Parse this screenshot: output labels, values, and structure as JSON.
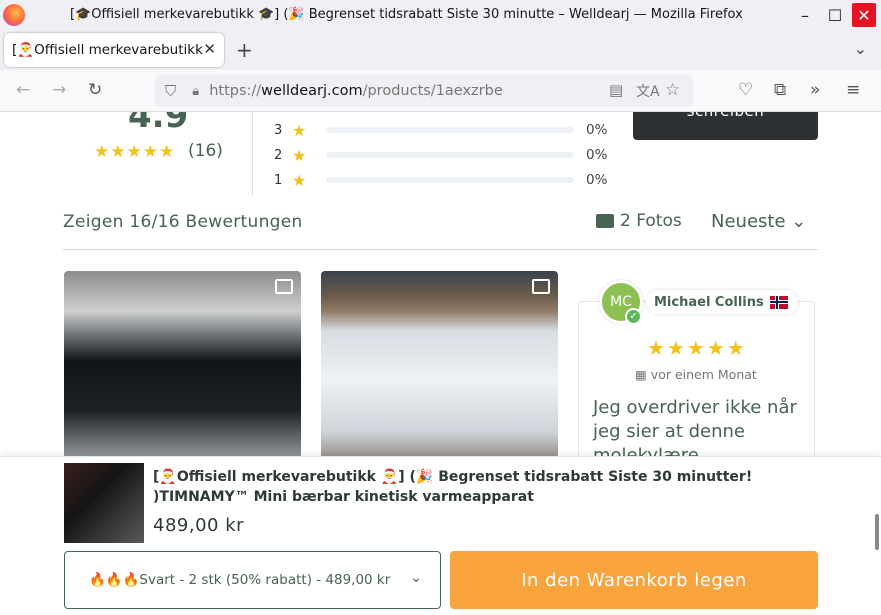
{
  "window": {
    "title": "[🎓Offisiell merkevarebutikk 🎓] (🎉 Begrenset tidsrabatt Siste 30 minutte – Welldearj — Mozilla Firefox"
  },
  "tabs": [
    {
      "label": "[🎅Offisiell merkevarebutikk"
    }
  ],
  "url": {
    "scheme": "https://",
    "host": "welldearj.com",
    "path": "/products/1aexzrbe"
  },
  "rating": {
    "average": "4.9",
    "stars": "★★★★★",
    "count": "(16)",
    "distribution": [
      {
        "stars": "3",
        "percent": "0%"
      },
      {
        "stars": "2",
        "percent": "0%"
      },
      {
        "stars": "1",
        "percent": "0%"
      }
    ],
    "write_button": "schreiben"
  },
  "reviews": {
    "summary": "Zeigen 16/16 Bewertungen",
    "photos": "2 Fotos",
    "sort": "Neueste",
    "card": {
      "avatar_initials": "MC",
      "name": "Michael Collins",
      "stars": "★★★★★",
      "date": "vor einem Monat",
      "text": "Jeg overdriver ikke når jeg sier at denne molekylære"
    }
  },
  "product": {
    "title": "[🎅Offisiell merkevarebutikk 🎅] (🎉 Begrenset tidsrabatt Siste 30 minutter! )TIMNAMY™ Mini bærbar kinetisk varmeapparat",
    "price": "489,00 kr",
    "variant": "🔥🔥🔥Svart - 2 stk (50% rabatt) - 489,00 kr",
    "cart_button": "In den Warenkorb legen"
  },
  "colors": {
    "accent": "#466451",
    "star": "#f4c21b",
    "cart": "#f8a33b"
  }
}
